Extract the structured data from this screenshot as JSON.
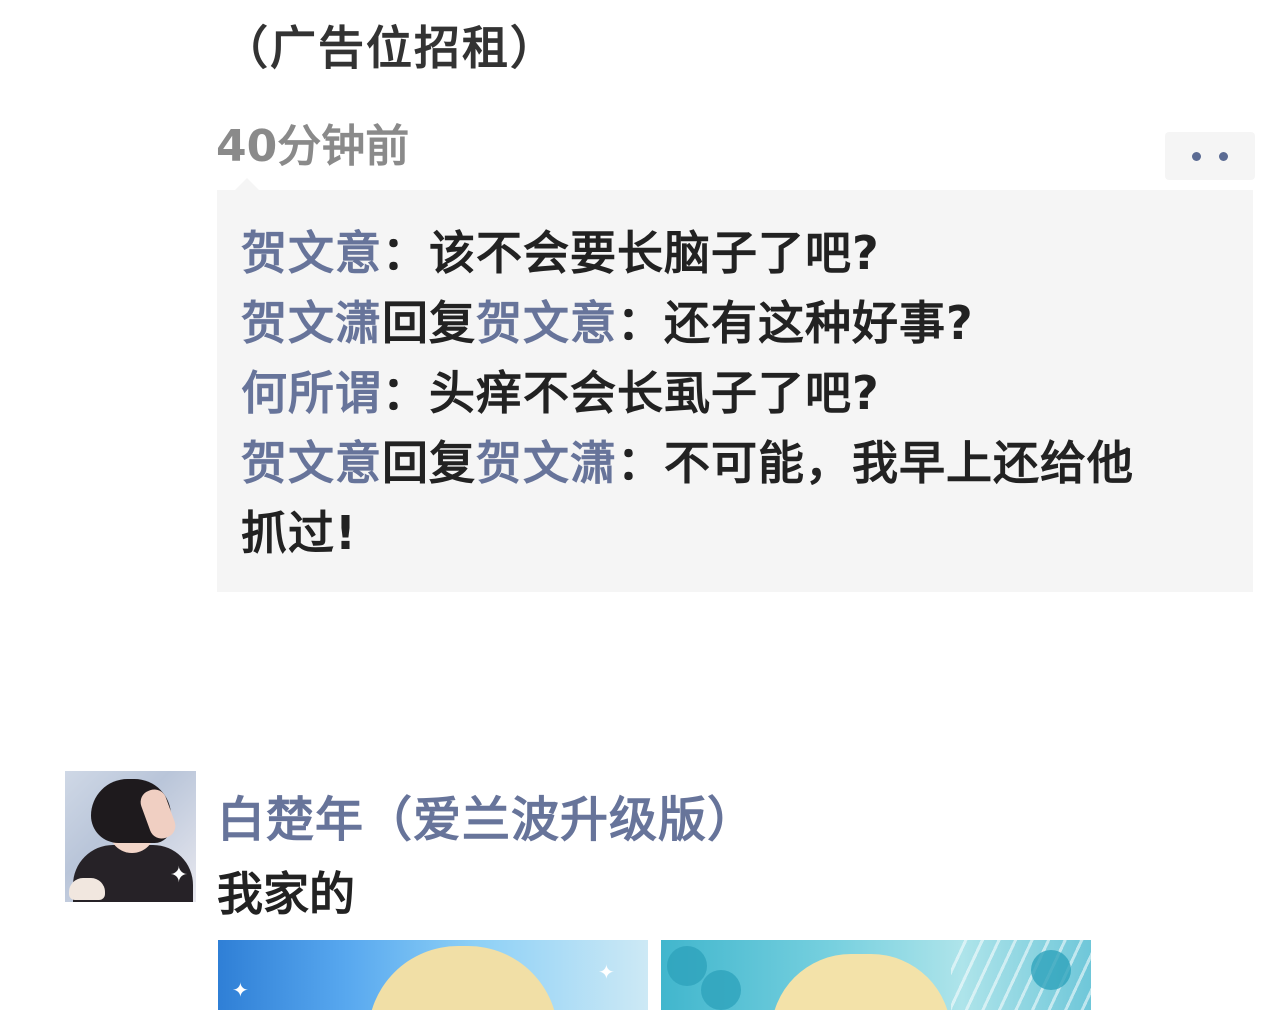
{
  "ad_line": "（广告位招租）",
  "timestamp": "40分钟前",
  "more_button": {
    "icon": "more-dots-icon",
    "accent": "#5b6b93"
  },
  "colors": {
    "name": "#67749a",
    "text": "#222222",
    "panel": "#f5f5f5",
    "meta": "#8a8a8a"
  },
  "comments": [
    {
      "author": "贺文意",
      "sep": "：",
      "text": "该不会要长脑子了吧?"
    },
    {
      "author": "贺文潇",
      "reply_word": "回复",
      "reply_to": "贺文意",
      "sep": "：",
      "text": "还有这种好事?"
    },
    {
      "author": "何所谓",
      "sep": "：",
      "text": "头痒不会长虱子了吧?"
    },
    {
      "author": "贺文意",
      "reply_word": "回复",
      "reply_to": "贺文潇",
      "sep": "：",
      "text_line1": "不可能，我早上还给他",
      "text_line2": "抓过!"
    }
  ],
  "post": {
    "author": "白楚年（爱兰波升级版）",
    "text": "我家的",
    "avatar_icon": "anime-avatar",
    "images": [
      "anime-blonde-character-image",
      "anime-blonde-character-floral-image"
    ]
  }
}
